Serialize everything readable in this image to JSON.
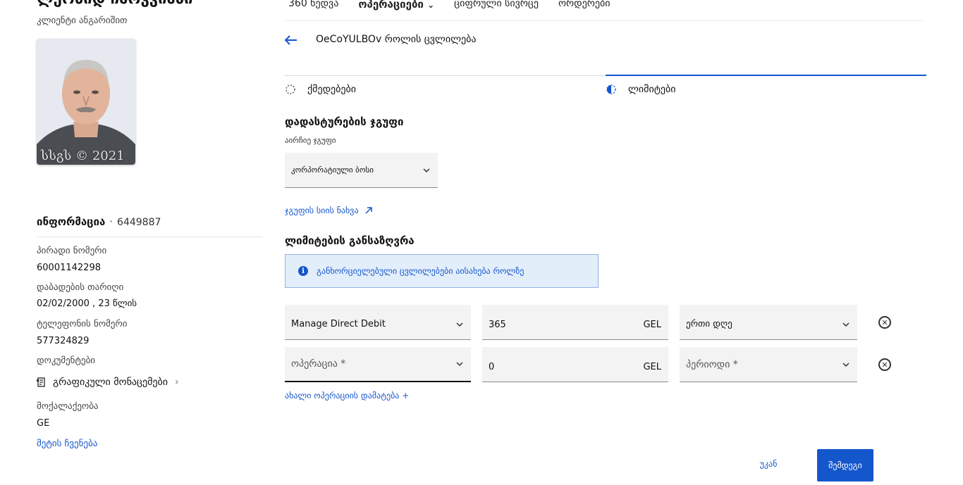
{
  "left_panel": {
    "client_name": "ლეონიდ ჩარკვიანი",
    "subcaption": "კლიენტი ანგარიშით",
    "photo_watermark": "სსგს © 2021",
    "info_title": "ინფორმაცია",
    "info_number": "6449887",
    "fields": [
      {
        "label": "პირადი ნომერი",
        "value": "60001142298"
      },
      {
        "label": "დაბადების თარიღი",
        "value": "02/02/2000 , 23 წლის"
      },
      {
        "label": "ტელეფონის ნომერი",
        "value": "577324829"
      },
      {
        "label": "დოკუმენტები",
        "value": ""
      }
    ],
    "documents_link": "გრაფიკული მონაცემები",
    "citizenship_label": "მოქალაქეობა",
    "citizenship_value": "GE",
    "more_link": "მეტის ჩვენება"
  },
  "top_nav": {
    "items": [
      "360 ხედვა",
      "ოპერაციები",
      "ციფრული სივრცე",
      "ორდერები"
    ]
  },
  "header": {
    "title": "OeCoYULBOv როლის ცვლილება"
  },
  "tabs": [
    {
      "label": "ქმედებები",
      "active": false
    },
    {
      "label": "ლიმიტები",
      "active": true
    }
  ],
  "approval_group": {
    "title": "დადასტურების ჯგუფი",
    "select_label": "აირჩიე ჯგუფი",
    "selected": "კორპორატიული ბოსი",
    "view_list_link": "ჯგუფის სიის ნახვა"
  },
  "limits": {
    "title": "ლიმიტების განსაზღვრა",
    "banner": "განხორციელებული ცვლილებები აისახება როლზე",
    "rows": [
      {
        "operation": "Manage Direct Debit",
        "operation_placeholder": "",
        "amount": "365",
        "currency": "GEL",
        "period": "ერთი დღე",
        "period_placeholder": ""
      },
      {
        "operation": "",
        "operation_placeholder": "ოპერაცია *",
        "amount": "0",
        "currency": "GEL",
        "period": "",
        "period_placeholder": "პერიოდი *"
      }
    ],
    "add_operation": "ახალი ოპერაციის დამატება +"
  },
  "footer": {
    "back_label": "უკან",
    "next_label": "შემდეგი"
  },
  "colors": {
    "accent": "#1456cc",
    "banner_bg": "#e3eefb",
    "field_bg": "#f3f3f3"
  }
}
